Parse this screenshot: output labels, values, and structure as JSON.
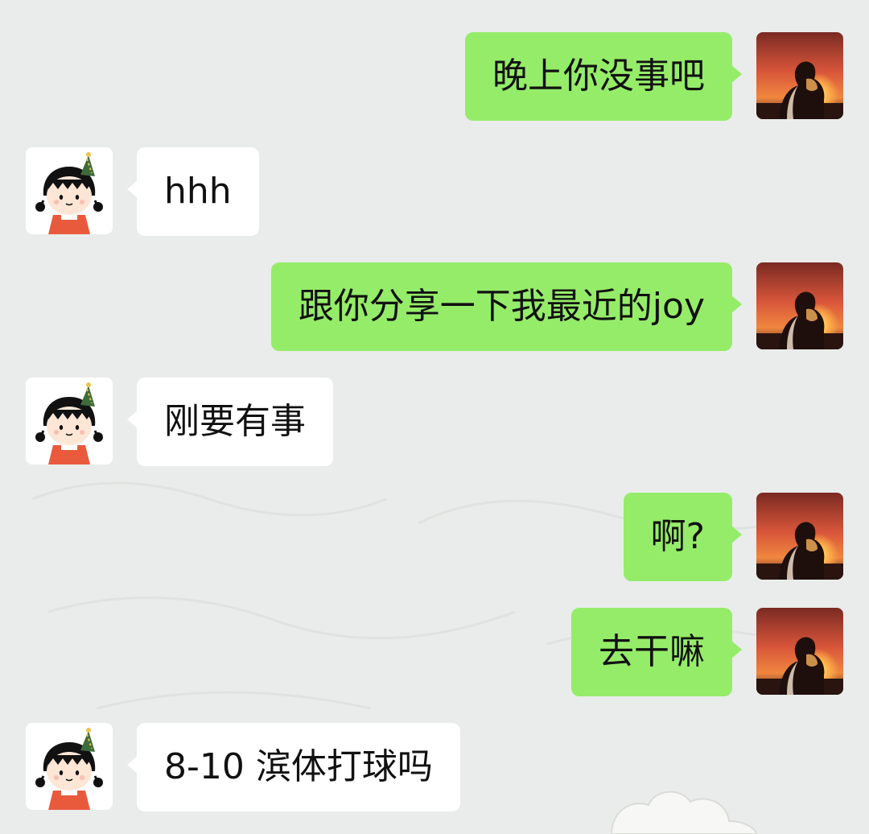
{
  "colors": {
    "background": "#e9ecea",
    "outgoing_bubble": "#95ec69",
    "incoming_bubble": "#ffffff",
    "text": "#111111"
  },
  "messages": [
    {
      "sender": "me",
      "avatar": "sunset-silhouette-avatar",
      "text": "晚上你没事吧"
    },
    {
      "sender": "friend",
      "avatar": "chibi-maruko-avatar",
      "text": "hhh"
    },
    {
      "sender": "me",
      "avatar": "sunset-silhouette-avatar",
      "text": "跟你分享一下我最近的joy"
    },
    {
      "sender": "friend",
      "avatar": "chibi-maruko-avatar",
      "text": "刚要有事"
    },
    {
      "sender": "me",
      "avatar": "sunset-silhouette-avatar",
      "text": "啊?"
    },
    {
      "sender": "me",
      "avatar": "sunset-silhouette-avatar",
      "text": "去干嘛"
    },
    {
      "sender": "friend",
      "avatar": "chibi-maruko-avatar",
      "text": "8-10 滨体打球吗"
    }
  ]
}
